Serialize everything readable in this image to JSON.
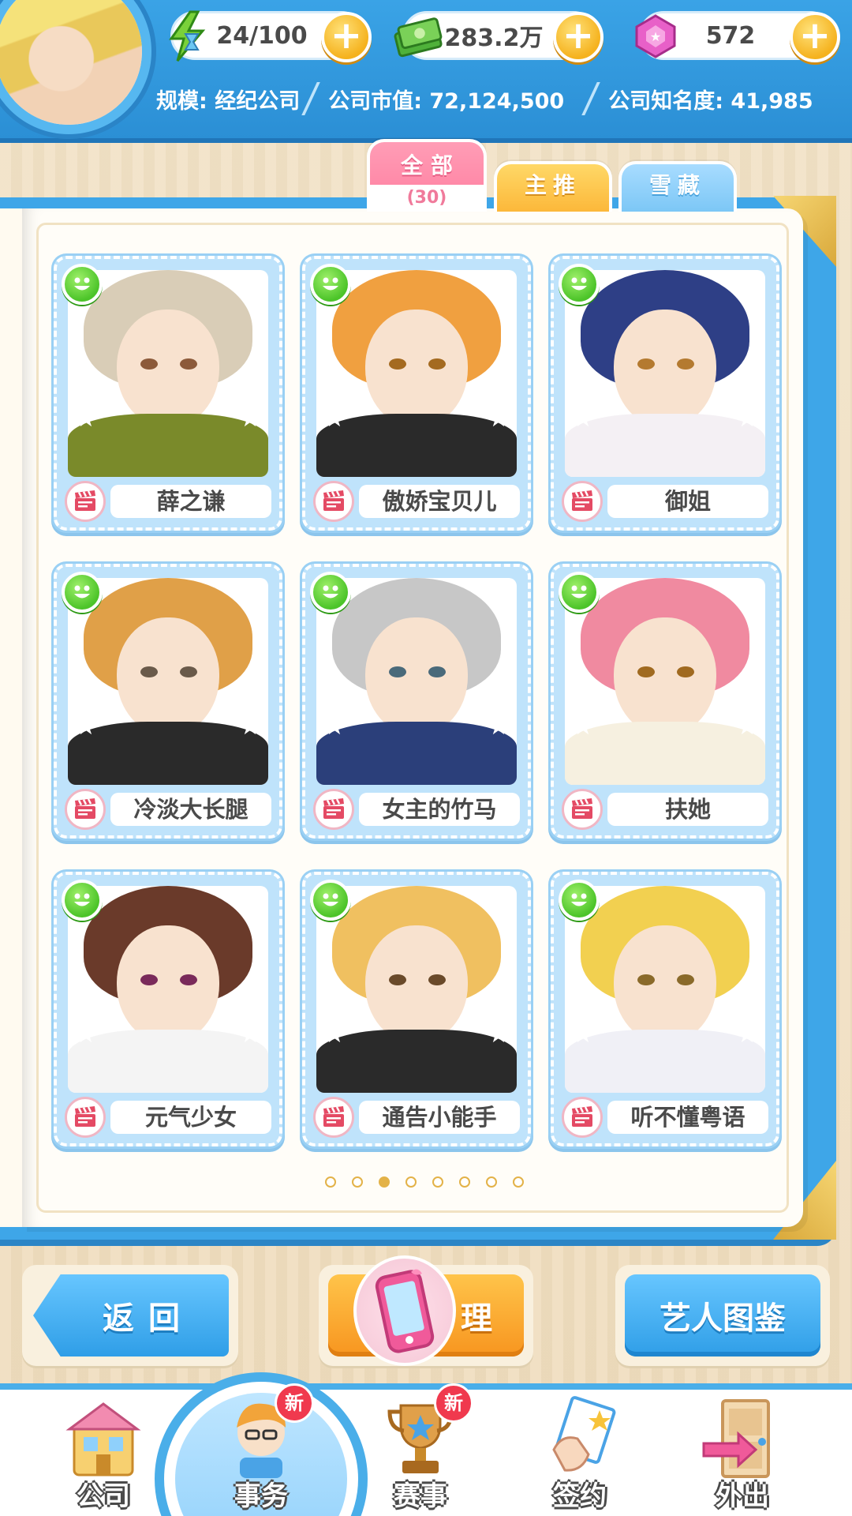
{
  "resources": {
    "stamina": {
      "value": "24/100",
      "icon": "stamina-icon"
    },
    "money": {
      "value": "283.2万",
      "icon": "money-icon"
    },
    "gems": {
      "value": "572",
      "icon": "gem-icon"
    },
    "plus": "+"
  },
  "stats": {
    "scale": "规模: 经纪公司",
    "market_value": "公司市值: 72,124,500",
    "fame": "公司知名度: 41,985"
  },
  "tabs": {
    "all": {
      "label": "全部",
      "count": "(30)"
    },
    "featured": {
      "label": "主推"
    },
    "hidden": {
      "label": "雪藏"
    }
  },
  "artists": [
    {
      "name": "薛之谦",
      "hair": "#d9cdb7",
      "body": "#7a8a2a",
      "eye": "#8c5a3a"
    },
    {
      "name": "傲娇宝贝儿",
      "hair": "#f0a040",
      "body": "#2a2a2a",
      "eye": "#a46a20"
    },
    {
      "name": "御姐",
      "hair": "#2e3f86",
      "body": "#f4f0f4",
      "eye": "#b47a30"
    },
    {
      "name": "冷淡大长腿",
      "hair": "#e0a048",
      "body": "#2a2a2a",
      "eye": "#6a5a4a"
    },
    {
      "name": "女主的竹马",
      "hair": "#c7c7c7",
      "body": "#2b3f7a",
      "eye": "#4a6a7a"
    },
    {
      "name": "扶她",
      "hair": "#f08aa0",
      "body": "#f6f0e0",
      "eye": "#a06a20"
    },
    {
      "name": "元气少女",
      "hair": "#6a3a2a",
      "body": "#f4f4f4",
      "eye": "#7a2a5a"
    },
    {
      "name": "通告小能手",
      "hair": "#f0c060",
      "body": "#2a2a2a",
      "eye": "#6a4a2a"
    },
    {
      "name": "听不懂粤语",
      "hair": "#f2d050",
      "body": "#f0f0f6",
      "eye": "#8a6a2a"
    }
  ],
  "pager": {
    "total": 8,
    "active": 3
  },
  "actions": {
    "back": "返回",
    "manage": "理",
    "gallery": "艺人图鉴"
  },
  "bottom_nav": [
    {
      "label": "公司",
      "icon": "company-icon",
      "new": false
    },
    {
      "label": "事务",
      "icon": "affairs-icon",
      "new": true
    },
    {
      "label": "赛事",
      "icon": "trophy-icon",
      "new": true
    },
    {
      "label": "签约",
      "icon": "contract-icon",
      "new": false
    },
    {
      "label": "外出",
      "icon": "door-icon",
      "new": false
    }
  ],
  "new_badge": "新",
  "colors": {
    "accent_blue": "#3aa3e6",
    "tab_pink": "#ff7d9f",
    "tab_yellow": "#fcb83a",
    "tab_light_blue": "#7cc7f6",
    "badge_green": "#4cc429"
  }
}
